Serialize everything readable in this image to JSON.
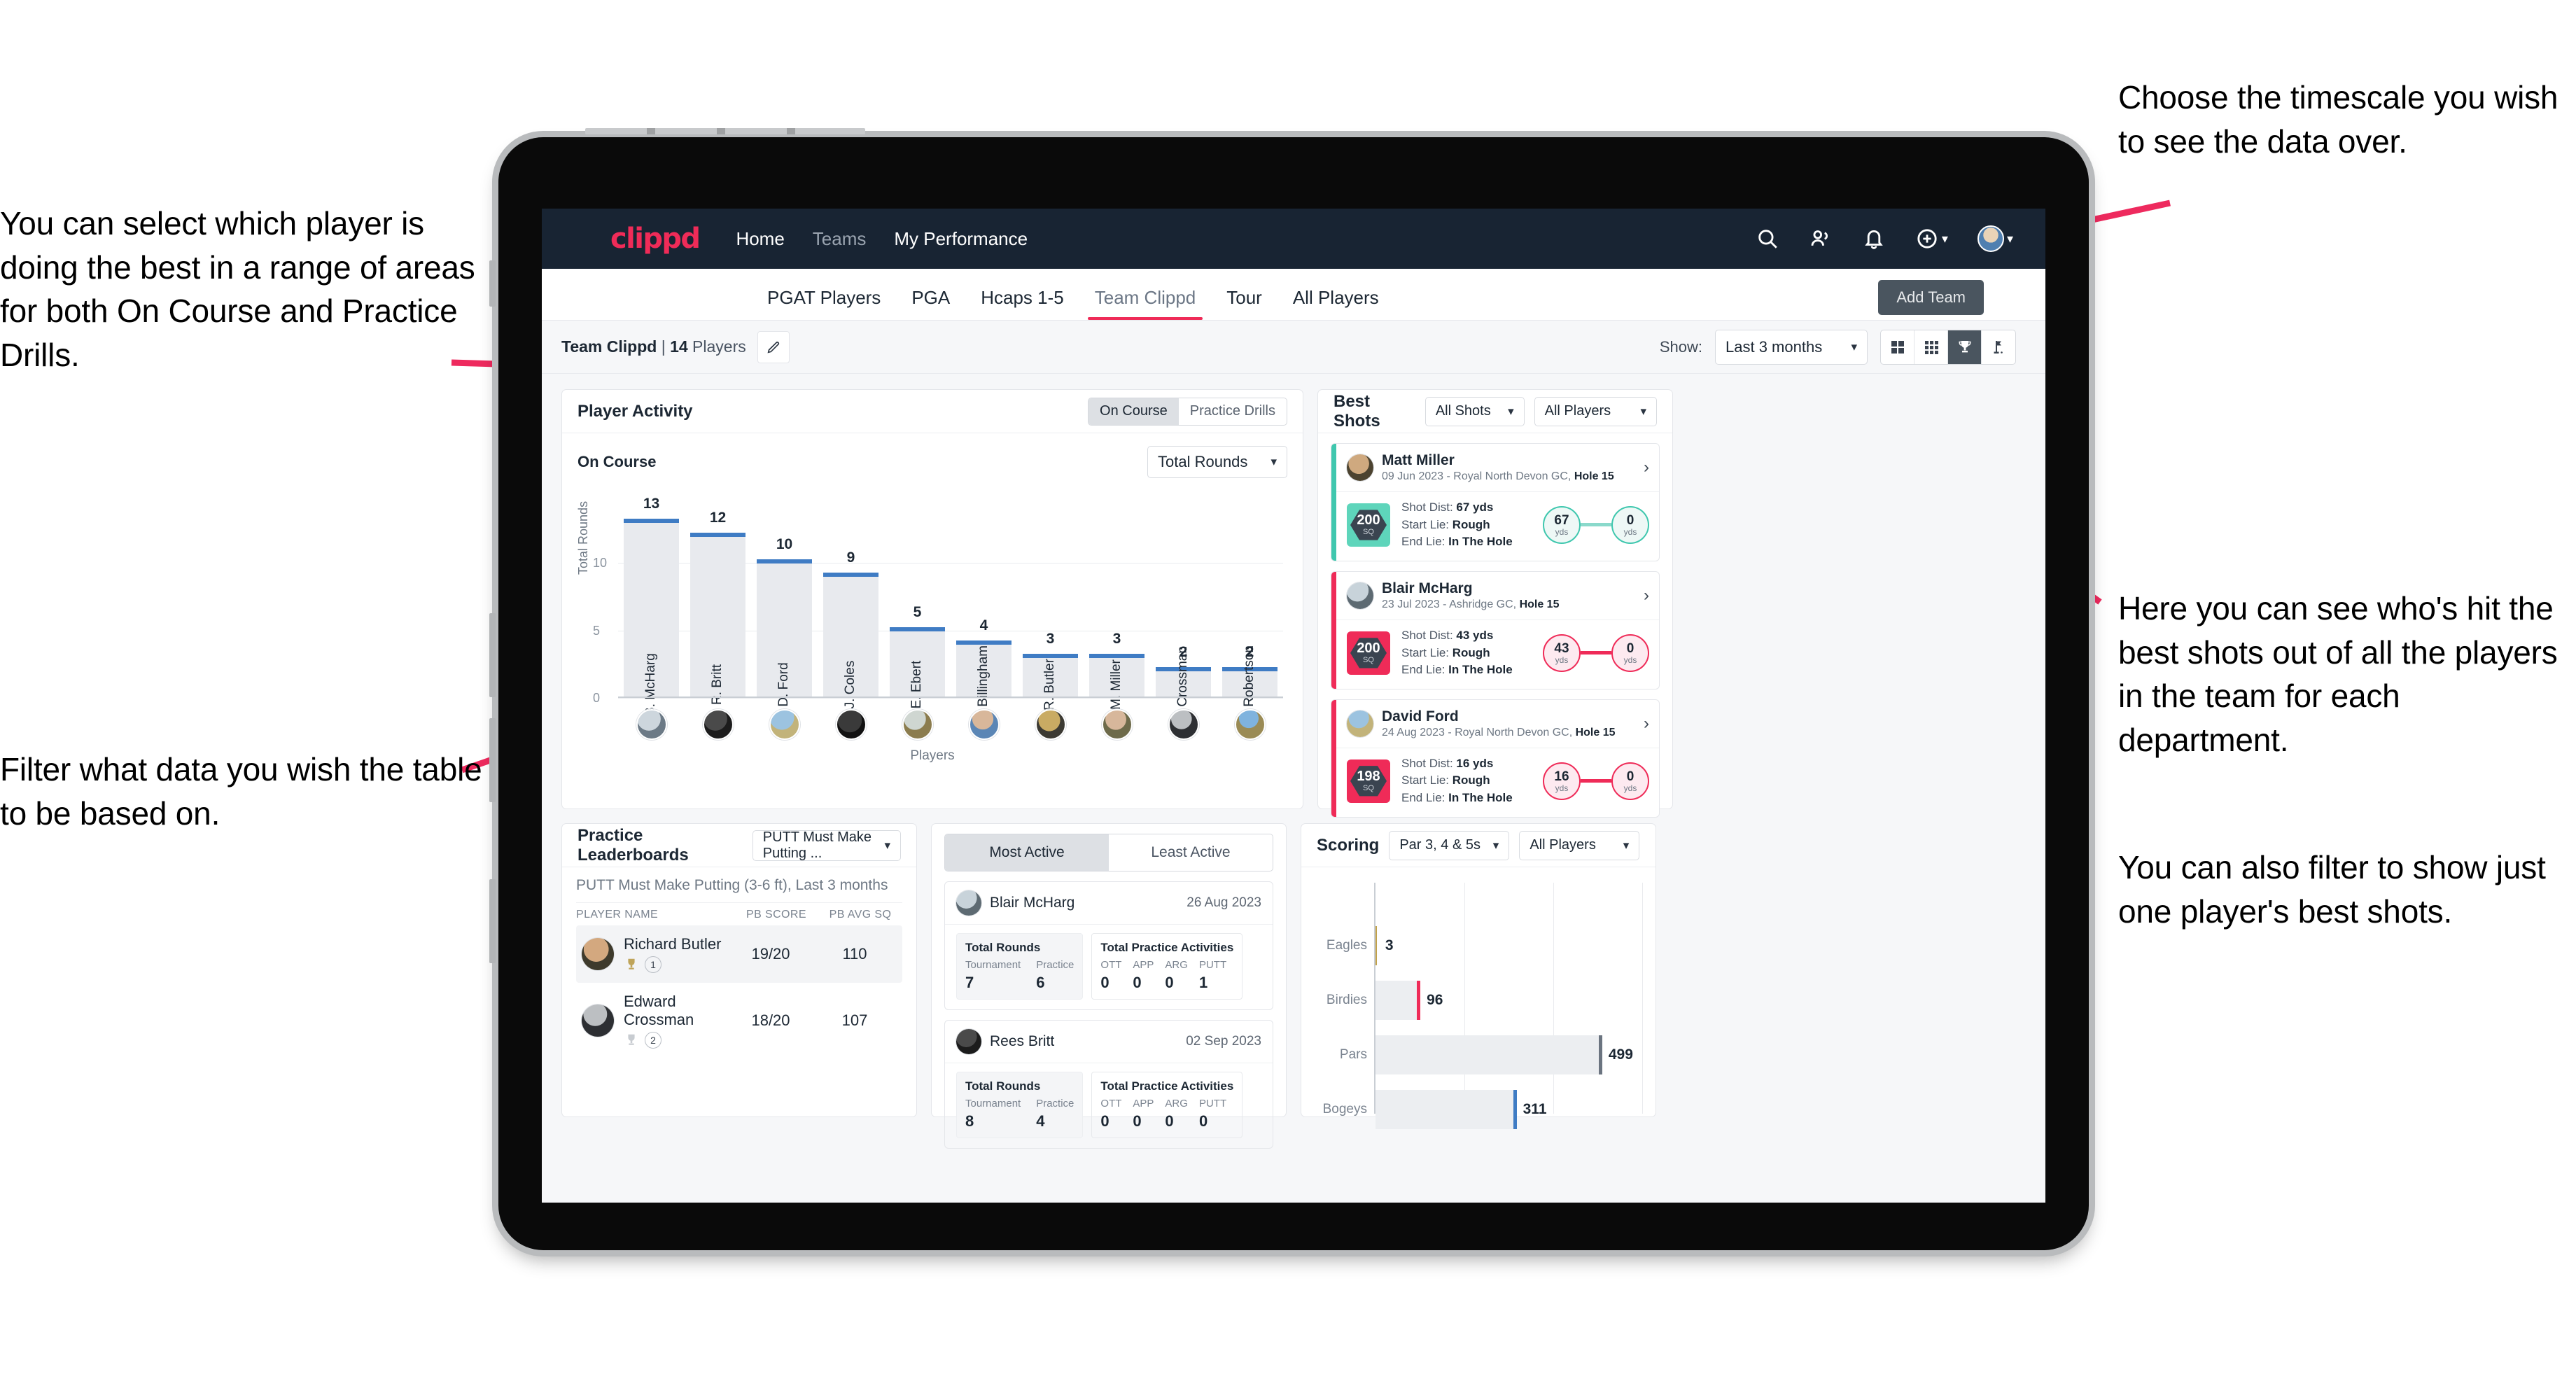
{
  "annotations": {
    "left_top": "You can select which player is doing the best in a range of areas for both On Course and Practice Drills.",
    "left_bottom": "Filter what data you wish the table to be based on.",
    "right_top": "Choose the timescale you wish to see the data over.",
    "right_mid": "Here you can see who's hit the best shots out of all the players in the team for each department.",
    "right_bottom": "You can also filter to show just one player's best shots."
  },
  "navbar": {
    "brand": "clippd",
    "links": [
      {
        "label": "Home",
        "active": true
      },
      {
        "label": "Teams",
        "active": false
      },
      {
        "label": "My Performance",
        "active": true
      }
    ],
    "icons": [
      "search-icon",
      "people-icon",
      "bell-icon",
      "plus-circle-icon",
      "avatar"
    ]
  },
  "tabs": [
    {
      "label": "PGAT Players",
      "active": false
    },
    {
      "label": "PGA",
      "active": false
    },
    {
      "label": "Hcaps 1-5",
      "active": false
    },
    {
      "label": "Team Clippd",
      "active": true
    },
    {
      "label": "Tour",
      "active": false
    },
    {
      "label": "All Players",
      "active": false
    }
  ],
  "add_team_button": "Add Team",
  "subbar": {
    "team_name": "Team Clippd",
    "separator": " | ",
    "player_count": "14",
    "players_word": " Players",
    "show_label": "Show:",
    "timescale_value": "Last 3 months",
    "view_buttons": [
      "grid-2x2-icon",
      "grid-3x3-icon",
      "trophy-icon",
      "flag-icon"
    ],
    "active_view": "trophy-icon"
  },
  "player_activity": {
    "title": "Player Activity",
    "segments": [
      {
        "label": "On Course",
        "active": true
      },
      {
        "label": "Practice Drills",
        "active": false
      }
    ],
    "sub_title": "On Course",
    "metric_value": "Total Rounds"
  },
  "chart_data": [
    {
      "type": "bar",
      "title": "Player Activity",
      "xlabel": "Players",
      "ylabel": "Total Rounds",
      "categories": [
        "B. McHarg",
        "R. Britt",
        "D. Ford",
        "J. Coles",
        "E. Ebert",
        "D. Billingham",
        "R. Butler",
        "M. Miller",
        "E. Crossman",
        "C. Robertson"
      ],
      "values": [
        13,
        12,
        10,
        9,
        5,
        4,
        3,
        3,
        2,
        2
      ],
      "ylim": [
        0,
        14
      ],
      "yticks": [
        0,
        5,
        10
      ],
      "grid": true,
      "bar_color": "#e8eaee",
      "cap_color": "#3f7cc4"
    },
    {
      "type": "bar",
      "orientation": "horizontal",
      "title": "Scoring",
      "categories": [
        "Eagles",
        "Birdies",
        "Pars",
        "Bogeys"
      ],
      "values": [
        3,
        96,
        499,
        311
      ],
      "xlim": [
        0,
        600
      ],
      "grid": true,
      "cap_colors": [
        "#c2a24a",
        "#ef2b58",
        "#6b7480",
        "#3f7cc4"
      ]
    }
  ],
  "best_shots": {
    "title": "Best Shots",
    "filter_shots": "All Shots",
    "filter_players": "All Players",
    "shots": [
      {
        "player": "Matt Miller",
        "meta_date": "09 Jun 2023 - Royal North Devon GC, ",
        "meta_hole": "Hole 15",
        "score": "200",
        "score_unit": "SQ",
        "shot_dist_label": "Shot Dist: ",
        "shot_dist": "67 yds",
        "start_lie_label": "Start Lie: ",
        "start_lie": "Rough",
        "end_lie_label": "End Lie: ",
        "end_lie": "In The Hole",
        "from_value": "67",
        "from_unit": "yds",
        "to_value": "0",
        "to_unit": "yds",
        "accent": "#3fc7ae"
      },
      {
        "player": "Blair McHarg",
        "meta_date": "23 Jul 2023 - Ashridge GC, ",
        "meta_hole": "Hole 15",
        "score": "200",
        "score_unit": "SQ",
        "shot_dist_label": "Shot Dist: ",
        "shot_dist": "43 yds",
        "start_lie_label": "Start Lie: ",
        "start_lie": "Rough",
        "end_lie_label": "End Lie: ",
        "end_lie": "In The Hole",
        "from_value": "43",
        "from_unit": "yds",
        "to_value": "0",
        "to_unit": "yds",
        "accent": "#ef2b58"
      },
      {
        "player": "David Ford",
        "meta_date": "24 Aug 2023 - Royal North Devon GC, ",
        "meta_hole": "Hole 15",
        "score": "198",
        "score_unit": "SQ",
        "shot_dist_label": "Shot Dist: ",
        "shot_dist": "16 yds",
        "start_lie_label": "Start Lie: ",
        "start_lie": "Rough",
        "end_lie_label": "End Lie: ",
        "end_lie": "In The Hole",
        "from_value": "16",
        "from_unit": "yds",
        "to_value": "0",
        "to_unit": "yds",
        "accent": "#ef2b58"
      }
    ]
  },
  "practice_leaderboards": {
    "title": "Practice Leaderboards",
    "drill_select": "PUTT Must Make Putting ...",
    "sub_title": "PUTT Must Make Putting (3-6 ft),",
    "sub_period": " Last 3 months",
    "columns": [
      "PLAYER NAME",
      "PB SCORE",
      "PB AVG SQ"
    ],
    "rows": [
      {
        "name": "Richard Butler",
        "rank": "1",
        "pb_score": "19/20",
        "pb_avg_sq": "110",
        "highlight": true
      },
      {
        "name": "Edward Crossman",
        "rank": "2",
        "pb_score": "18/20",
        "pb_avg_sq": "107",
        "highlight": false
      }
    ]
  },
  "activity_panel": {
    "tabs": [
      {
        "label": "Most Active",
        "active": true
      },
      {
        "label": "Least Active",
        "active": false
      }
    ],
    "rounds_title": "Total Rounds",
    "practice_title": "Total Practice Activities",
    "rounds_cols": [
      "Tournament",
      "Practice"
    ],
    "practice_cols": [
      "OTT",
      "APP",
      "ARG",
      "PUTT"
    ],
    "players": [
      {
        "name": "Blair McHarg",
        "date": "26 Aug 2023",
        "rounds": [
          "7",
          "6"
        ],
        "practice": [
          "0",
          "0",
          "0",
          "1"
        ]
      },
      {
        "name": "Rees Britt",
        "date": "02 Sep 2023",
        "rounds": [
          "8",
          "4"
        ],
        "practice": [
          "0",
          "0",
          "0",
          "0"
        ]
      }
    ]
  },
  "scoring": {
    "title": "Scoring",
    "filter_par": "Par 3, 4 & 5s",
    "filter_players": "All Players"
  },
  "colors": {
    "brand_pink": "#ef2b58",
    "nav_dark": "#182433",
    "bar_blue": "#3f7cc4",
    "teal": "#3fc7ae",
    "page_bg": "#f6f7f9"
  }
}
